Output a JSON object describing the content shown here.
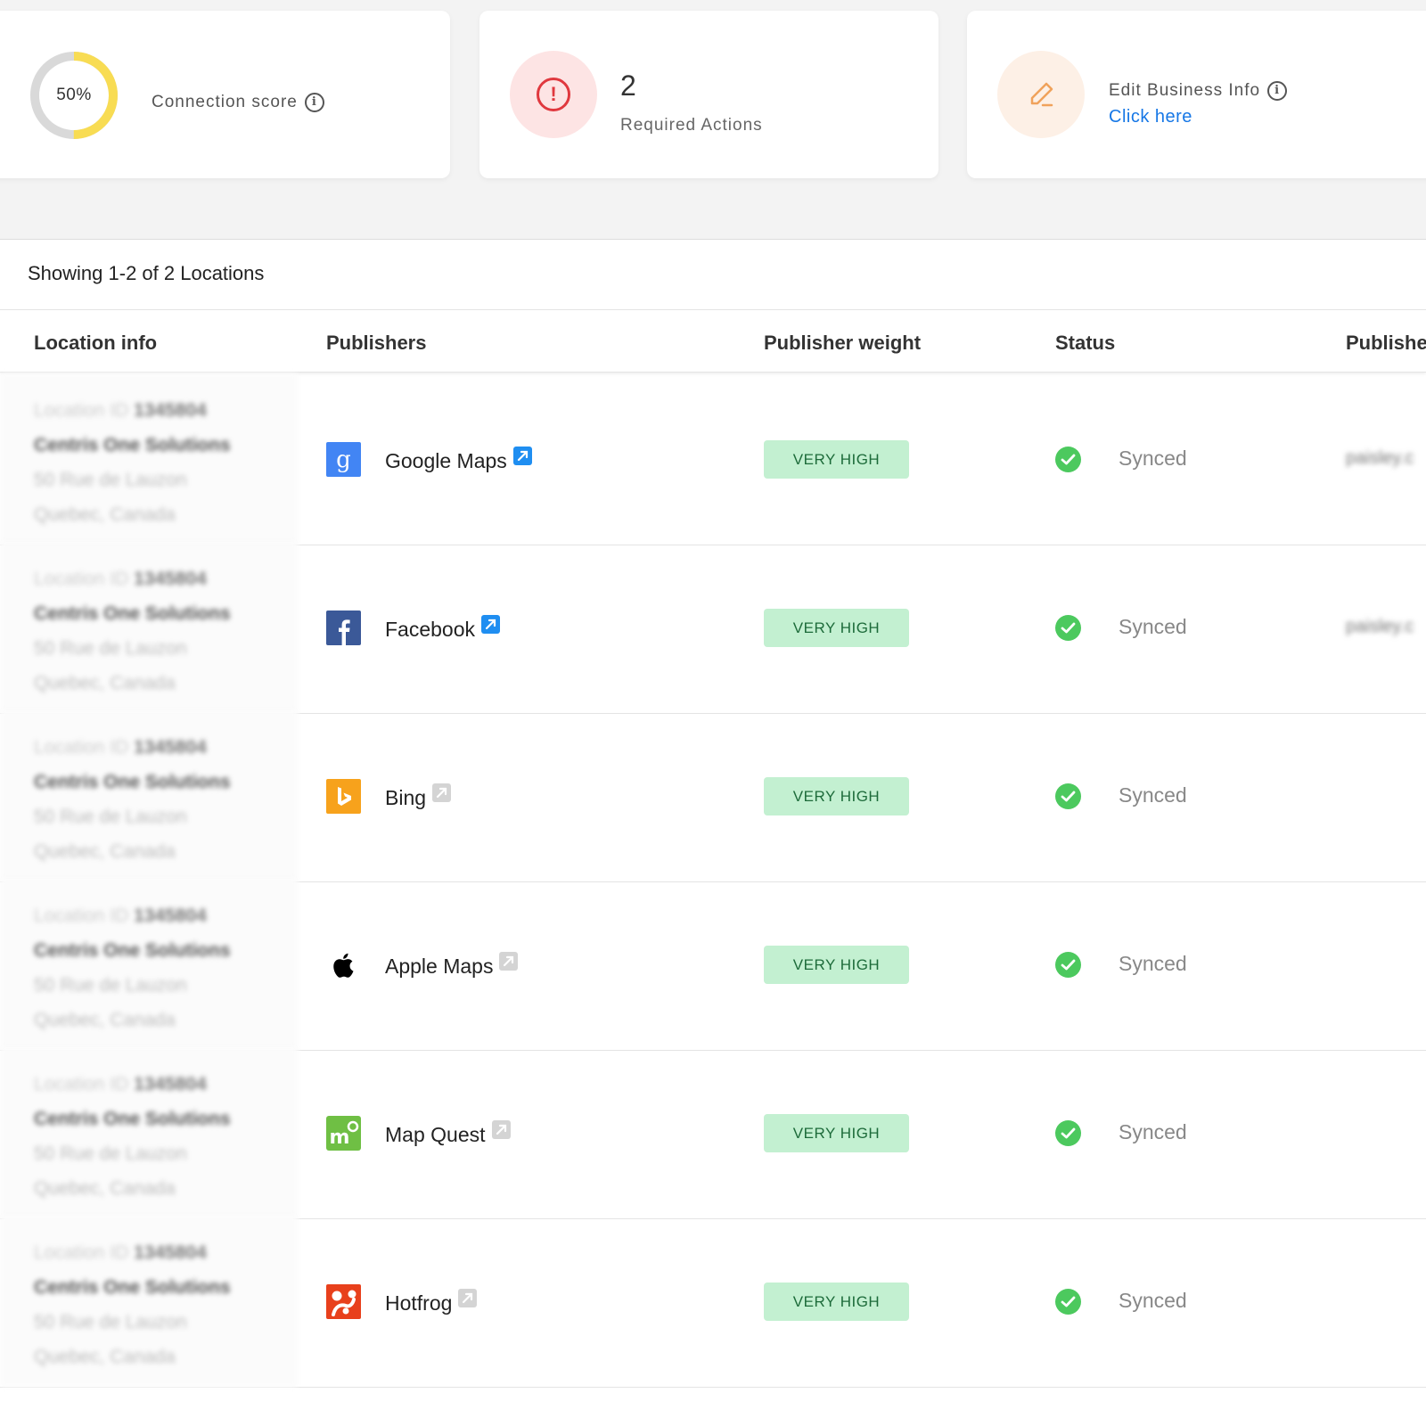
{
  "summary": {
    "connection_score": {
      "value_label": "50%",
      "percent": 50,
      "title": "Connection score",
      "info_icon": "info-icon"
    },
    "required_actions": {
      "count": "2",
      "label": "Required Actions",
      "icon": "alert-icon"
    },
    "edit_business": {
      "title": "Edit Business Info",
      "link_label": "Click here",
      "icon": "pencil-icon"
    }
  },
  "table": {
    "showing_text": "Showing 1-2 of 2 Locations",
    "headers": {
      "location": "Location info",
      "publishers": "Publishers",
      "weight": "Publisher weight",
      "status": "Status",
      "published": "Publishe"
    },
    "location": {
      "id_label": "Location ID",
      "id_value": "1345804",
      "name": "Centris One Solutions",
      "street": "50 Rue de Lauzon",
      "city": "Quebec, Canada"
    },
    "rows": [
      {
        "publisher": "Google Maps",
        "logo": "google-maps-logo",
        "link_active": true,
        "weight": "VERY HIGH",
        "status": "Synced",
        "published": "paisley.c"
      },
      {
        "publisher": "Facebook",
        "logo": "facebook-logo",
        "link_active": true,
        "weight": "VERY HIGH",
        "status": "Synced",
        "published": "paisley.c"
      },
      {
        "publisher": "Bing",
        "logo": "bing-logo",
        "link_active": false,
        "weight": "VERY HIGH",
        "status": "Synced",
        "published": ""
      },
      {
        "publisher": "Apple Maps",
        "logo": "apple-maps-logo",
        "link_active": false,
        "weight": "VERY HIGH",
        "status": "Synced",
        "published": ""
      },
      {
        "publisher": "Map Quest",
        "logo": "mapquest-logo",
        "link_active": false,
        "weight": "VERY HIGH",
        "status": "Synced",
        "published": ""
      },
      {
        "publisher": "Hotfrog",
        "logo": "hotfrog-logo",
        "link_active": false,
        "weight": "VERY HIGH",
        "status": "Synced",
        "published": ""
      }
    ]
  },
  "colors": {
    "donut_fill": "#f8dc53",
    "donut_track": "#d9d9d9",
    "link_blue": "#1677e6",
    "badge_bg": "#c3f0d1",
    "success_green": "#4cc95e",
    "alert_red": "#e0383e",
    "edit_orange": "#f0a25b"
  }
}
